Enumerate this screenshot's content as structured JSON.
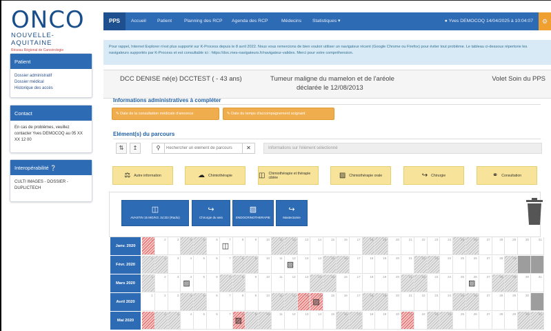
{
  "logo": {
    "name": "ONCO",
    "region": "NOUVELLE-AQUITAINE",
    "tagline": "Réseau Régional de Cancérologie"
  },
  "sidebar": {
    "patient": {
      "title": "Patient",
      "links": [
        "Dossier administratif",
        "Dossier médical",
        "Historique des accès"
      ]
    },
    "contact": {
      "title": "Contact",
      "text": "En cas de problèmes, veuillez contacter Yves DEMOCOQ au 05 XX XX 12 00"
    },
    "interop": {
      "title": "Interopérabilité",
      "text": "CULTI IMAGES - DOSSIER - DUPLICTECH"
    }
  },
  "navbar": {
    "brand": "PPS",
    "items": [
      "Accueil",
      "Patient",
      "Planning des RCP",
      "Agenda des RCP",
      "Médecins",
      "Statistiques ▾"
    ],
    "user": "Yves DEMOCOQ 14/04/2025 à 10:04:07"
  },
  "info": {
    "text": "Pour rappel, Internet Explorer n'est plus supporté sur K-Process depuis le 8 avril 2022. Nous vous remercions de bien vouloir utiliser un navigateur récent (Google Chrome ou Firefox) pour éviter tout problème. Le tableau ci-dessous répertorie les navigateurs supportés par K-Process et est consultable ici : https://doc.mes-navigateurs.fr/navigateur-valides. Merci pour votre compréhension."
  },
  "patient": {
    "name": "DCC DENISE né(e) DCCTEST ( - 43 ans)",
    "diagnosis": "Tumeur maligne du mamelon et de l'aréole",
    "declared": "déclarée le 12/08/2013",
    "volet": "Volet Soin du PPS"
  },
  "admin": {
    "title": "Informations administratives à compléter",
    "btn1": "Date de la consultation médicale d'annonce",
    "btn2": "Date du temps d'accompagnement soignant"
  },
  "parcours": {
    "title": "Elément(s) du parcours",
    "search_placeholder": "Rechercher un élément de parcours",
    "info_placeholder": "Informations sur l'élément sélectionné"
  },
  "categories": [
    {
      "label": "Autre information",
      "icon": "hospital-icon"
    },
    {
      "label": "Chimiothérapie",
      "icon": "syringe-icon"
    },
    {
      "label": "Chimiothérapie et thérapie ciblée",
      "icon": "pills-icon"
    },
    {
      "label": "Chimiothérapie orale",
      "icon": "pill-icon"
    },
    {
      "label": "Chirurgie",
      "icon": "scalpel-icon"
    },
    {
      "label": "Consultation",
      "icon": "stethoscope-icon"
    }
  ],
  "actions": [
    {
      "label": "AVASTIN 15 MG/KG J1/J22 (Radio)",
      "icon": "pills-icon"
    },
    {
      "label": "Chirurgie du sein",
      "icon": "scalpel-icon"
    },
    {
      "label": "ENDOCRINOTHERAPIE",
      "icon": "syringe-icon"
    },
    {
      "label": "Mastectomie",
      "icon": "scalpel-icon"
    }
  ],
  "calendar": {
    "months": [
      {
        "label": "Janv. 2020",
        "start": 1
      },
      {
        "label": "Févr. 2020",
        "start": 1
      },
      {
        "label": "Mars 2020",
        "start": 1
      },
      {
        "label": "Avril 2020",
        "start": 1
      },
      {
        "label": "Mai 2020",
        "start": 1
      }
    ]
  }
}
